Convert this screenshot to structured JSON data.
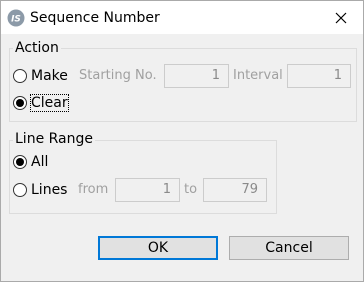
{
  "window": {
    "title": "Sequence Number",
    "close_glyph": "✕",
    "app_icon": "app-logo-icon"
  },
  "action": {
    "legend": "Action",
    "make_label": "Make",
    "make_selected": false,
    "starting_no_label": "Starting No.",
    "starting_no_value": "1",
    "interval_label": "Interval",
    "interval_value": "1",
    "clear_label": "Clear",
    "clear_selected": true
  },
  "line_range": {
    "legend": "Line Range",
    "all_label": "All",
    "all_selected": true,
    "lines_label": "Lines",
    "lines_selected": false,
    "from_label": "from",
    "from_value": "1",
    "to_label": "to",
    "to_value": "79"
  },
  "buttons": {
    "ok_label": "OK",
    "cancel_label": "Cancel"
  },
  "colors": {
    "accent": "#0078d7",
    "dialog_bg": "#f0f0f0"
  }
}
